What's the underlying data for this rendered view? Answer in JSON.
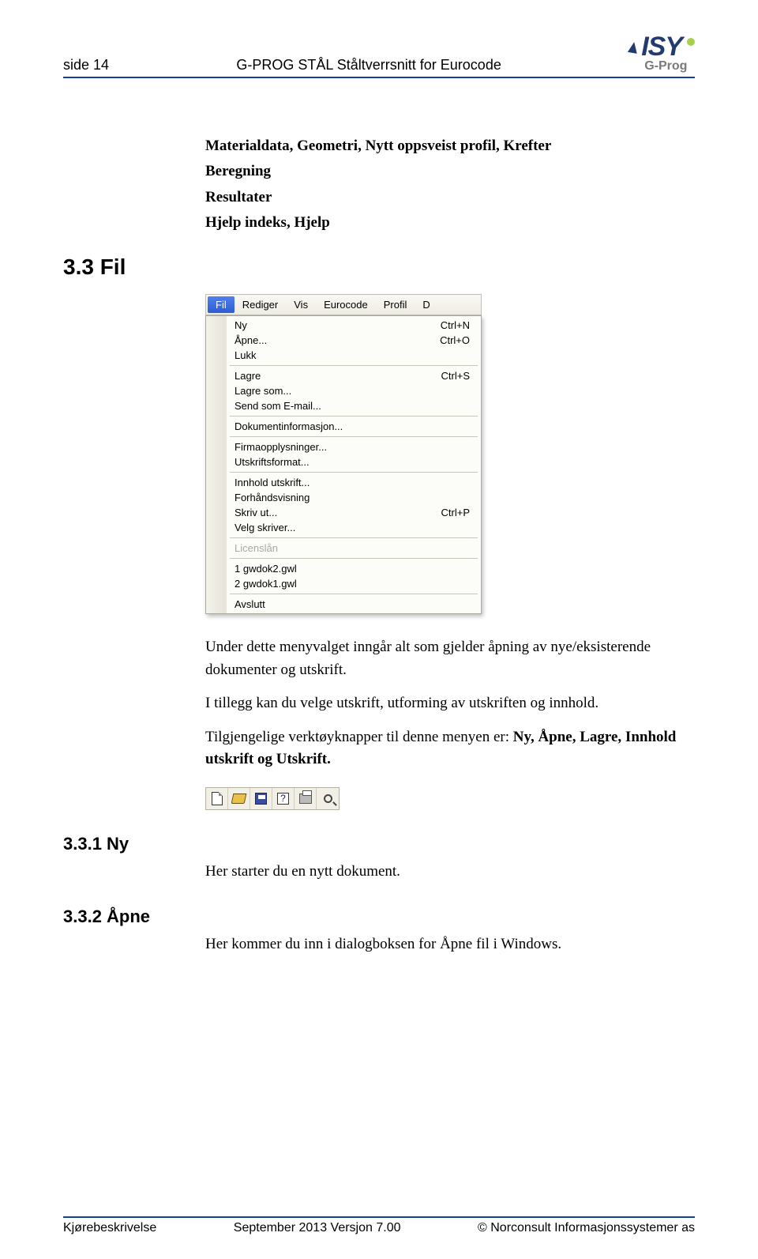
{
  "header": {
    "left": "side 14",
    "center": "G-PROG STÅL Ståltverrsnitt for Eurocode",
    "logo_text": "ISY",
    "logo_sub": "G-Prog"
  },
  "intro_lines": [
    "Materialdata, Geometri, Nytt oppsveist profil, Krefter",
    "Beregning",
    "Resultater",
    "Hjelp indeks, Hjelp"
  ],
  "section_fil": {
    "title": "3.3 Fil"
  },
  "menu": {
    "bar": [
      "Fil",
      "Rediger",
      "Vis",
      "Eurocode",
      "Profil",
      "D"
    ],
    "bar_active_index": 0,
    "groups": [
      {
        "items": [
          {
            "label": "Ny",
            "shortcut": "Ctrl+N"
          },
          {
            "label": "Åpne...",
            "shortcut": "Ctrl+O"
          },
          {
            "label": "Lukk",
            "shortcut": ""
          }
        ]
      },
      {
        "items": [
          {
            "label": "Lagre",
            "shortcut": "Ctrl+S"
          },
          {
            "label": "Lagre som...",
            "shortcut": ""
          },
          {
            "label": "Send som E-mail...",
            "shortcut": ""
          }
        ]
      },
      {
        "items": [
          {
            "label": "Dokumentinformasjon...",
            "shortcut": ""
          }
        ]
      },
      {
        "items": [
          {
            "label": "Firmaopplysninger...",
            "shortcut": ""
          },
          {
            "label": "Utskriftsformat...",
            "shortcut": ""
          }
        ]
      },
      {
        "items": [
          {
            "label": "Innhold utskrift...",
            "shortcut": ""
          },
          {
            "label": "Forhåndsvisning",
            "shortcut": ""
          },
          {
            "label": "Skriv ut...",
            "shortcut": "Ctrl+P"
          },
          {
            "label": "Velg skriver...",
            "shortcut": ""
          }
        ]
      },
      {
        "items": [
          {
            "label": "Licenslån",
            "shortcut": "",
            "disabled": true
          }
        ]
      },
      {
        "items": [
          {
            "label": "1 gwdok2.gwl",
            "shortcut": ""
          },
          {
            "label": "2 gwdok1.gwl",
            "shortcut": ""
          }
        ]
      },
      {
        "items": [
          {
            "label": "Avslutt",
            "shortcut": ""
          }
        ]
      }
    ]
  },
  "para": {
    "p1": "Under dette menyvalget inngår alt som gjelder åpning av nye/eksisterende dokumenter og utskrift.",
    "p2": "I tillegg kan du velge utskrift, utforming av utskriften og innhold.",
    "p3_pre": "Tilgjengelige verktøyknapper til denne menyen er: ",
    "p3_bold": "Ny, Åpne, Lagre, Innhold utskrift og Utskrift."
  },
  "toolbar_icons": [
    "new",
    "open",
    "save",
    "content",
    "print",
    "preview"
  ],
  "sub1": {
    "title": "3.3.1 Ny",
    "text": "Her starter du en nytt dokument."
  },
  "sub2": {
    "title": "3.3.2 Åpne",
    "text": "Her kommer du inn i dialogboksen for Åpne fil i Windows."
  },
  "footer": {
    "left": "Kjørebeskrivelse",
    "center": "September 2013 Versjon 7.00",
    "right": "© Norconsult Informasjonssystemer as"
  }
}
